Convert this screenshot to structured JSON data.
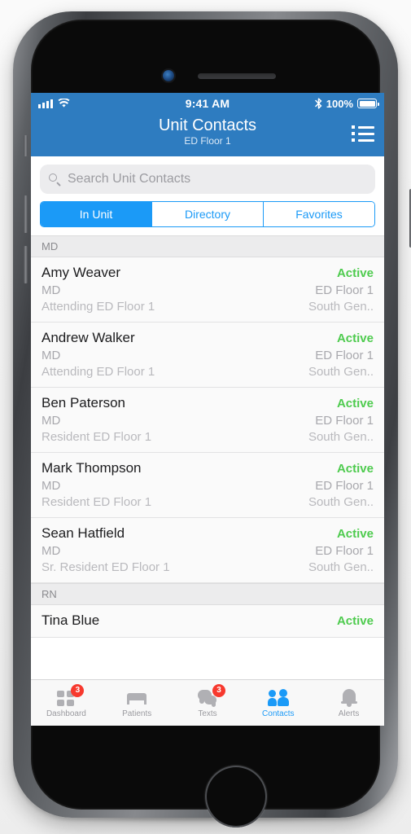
{
  "status_bar": {
    "signal_icon": "cellular-bars-icon",
    "wifi_icon": "wifi-icon",
    "time": "9:41 AM",
    "bluetooth_icon": "bluetooth-icon",
    "battery_percent": "100%",
    "battery_icon": "battery-full-icon"
  },
  "nav": {
    "title": "Unit Contacts",
    "subtitle": "ED Floor 1",
    "action_icon": "list-view-icon"
  },
  "search": {
    "icon": "search-icon",
    "placeholder": "Search Unit Contacts",
    "value": ""
  },
  "segments": [
    {
      "label": "In Unit",
      "active": true
    },
    {
      "label": "Directory",
      "active": false
    },
    {
      "label": "Favorites",
      "active": false
    }
  ],
  "sections": [
    {
      "header": "MD",
      "rows": [
        {
          "name": "Amy Weaver",
          "status": "Active",
          "role": "MD",
          "unit": "ED Floor 1",
          "title": "Attending ED Floor 1",
          "org": "South Gen.."
        },
        {
          "name": "Andrew Walker",
          "status": "Active",
          "role": "MD",
          "unit": "ED Floor 1",
          "title": "Attending ED Floor 1",
          "org": "South Gen.."
        },
        {
          "name": "Ben Paterson",
          "status": "Active",
          "role": "MD",
          "unit": "ED Floor 1",
          "title": "Resident ED Floor 1",
          "org": "South Gen.."
        },
        {
          "name": "Mark Thompson",
          "status": "Active",
          "role": "MD",
          "unit": "ED Floor 1",
          "title": "Resident ED Floor 1",
          "org": "South Gen.."
        },
        {
          "name": "Sean Hatfield",
          "status": "Active",
          "role": "MD",
          "unit": "ED Floor 1",
          "title": "Sr. Resident ED Floor 1",
          "org": "South Gen.."
        }
      ]
    },
    {
      "header": "RN",
      "rows": [
        {
          "name": "Tina Blue",
          "status": "Active",
          "role": "",
          "unit": "",
          "title": "",
          "org": ""
        }
      ]
    }
  ],
  "tabs": [
    {
      "label": "Dashboard",
      "icon": "grid-icon",
      "badge": "3",
      "active": false
    },
    {
      "label": "Patients",
      "icon": "bed-icon",
      "badge": "",
      "active": false
    },
    {
      "label": "Texts",
      "icon": "chat-icon",
      "badge": "3",
      "active": false
    },
    {
      "label": "Contacts",
      "icon": "people-icon",
      "badge": "",
      "active": true
    },
    {
      "label": "Alerts",
      "icon": "bell-icon",
      "badge": "",
      "active": false
    }
  ],
  "colors": {
    "navbar_blue": "#2e7cc0",
    "accent_blue": "#1b9af7",
    "status_green": "#4ecb4e",
    "badge_red": "#f7392e"
  }
}
